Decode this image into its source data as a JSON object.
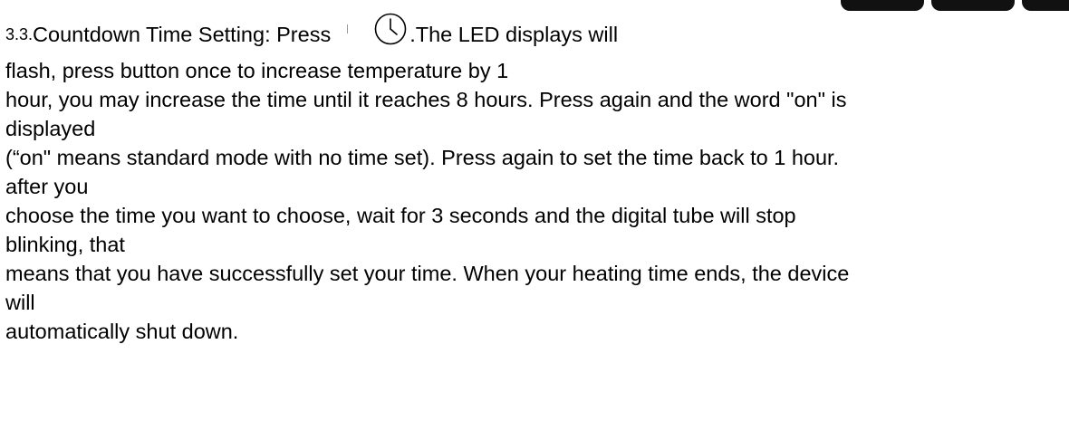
{
  "section": {
    "number": "3.3.",
    "heading": "Countdown Time Setting: Press",
    "after_icon": ".The LED displays will",
    "lines": [
      "flash, press button once to increase temperature by 1",
      "hour, you may increase the time until it reaches 8 hours. Press again and the word \"on\" is",
      "displayed",
      "(“on\" means standard mode with no time set). Press again to set the time back to 1 hour.",
      "after you",
      "choose the time you want to choose, wait for 3 seconds and the digital tube will stop",
      "blinking, that",
      "means that you have successfully set your time. When your heating time ends, the device",
      "will",
      "automatically shut down."
    ]
  },
  "icons": {
    "timer": "clock-icon"
  }
}
